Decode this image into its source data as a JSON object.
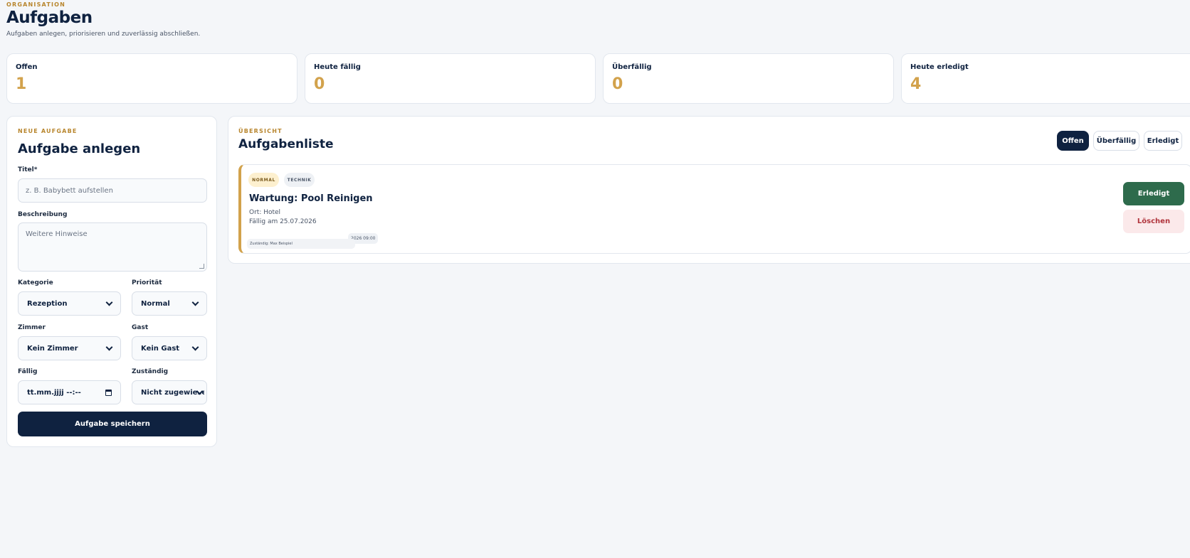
{
  "header": {
    "eyebrow": "ORGANISATION",
    "title": "Aufgaben",
    "subtitle": "Aufgaben anlegen, priorisieren und zuverlässig abschließen."
  },
  "stats": [
    {
      "label": "Offen",
      "value": "1"
    },
    {
      "label": "Heute fällig",
      "value": "0"
    },
    {
      "label": "Überfällig",
      "value": "0"
    },
    {
      "label": "Heute erledigt",
      "value": "4"
    }
  ],
  "form": {
    "eyebrow": "NEUE AUFGABE",
    "title": "Aufgabe anlegen",
    "title_label": "Titel*",
    "title_placeholder": "z. B. Babybett aufstellen",
    "description_label": "Beschreibung",
    "description_placeholder": "Weitere Hinweise",
    "category_label": "Kategorie",
    "category_value": "Rezeption",
    "priority_label": "Priorität",
    "priority_value": "Normal",
    "room_label": "Zimmer",
    "room_value": "Kein Zimmer",
    "guest_label": "Gast",
    "guest_value": "Kein Gast",
    "due_label": "Fällig",
    "due_value": "tt.mm.jjjj --:--",
    "assignee_label": "Zuständig",
    "assignee_value": "Nicht zugewiesen",
    "submit_label": "Aufgabe speichern"
  },
  "list": {
    "eyebrow": "ÜBERSICHT",
    "title": "Aufgabenliste",
    "filters": [
      {
        "label": "Offen",
        "active": true
      },
      {
        "label": "Überfällig",
        "active": false
      },
      {
        "label": "Erledigt",
        "active": false
      }
    ],
    "tasks": [
      {
        "badge_priority": "NORMAL",
        "badge_category": "TECHNIK",
        "title": "Wartung: Pool Reinigen",
        "location": "Ort: Hotel",
        "due": "Fällig am 25.07.2026",
        "chip_time": "2026 09:00",
        "chip_assignee": "Zuständig: Max Beispiel",
        "done_label": "Erledigt",
        "delete_label": "Löschen"
      }
    ]
  },
  "colors": {
    "navy": "#0f2240",
    "gold": "#d2a24c",
    "green": "#2e6b4c",
    "danger_bg": "#fbe9ea",
    "danger_text": "#b0343c",
    "background": "#f4f6f9"
  }
}
